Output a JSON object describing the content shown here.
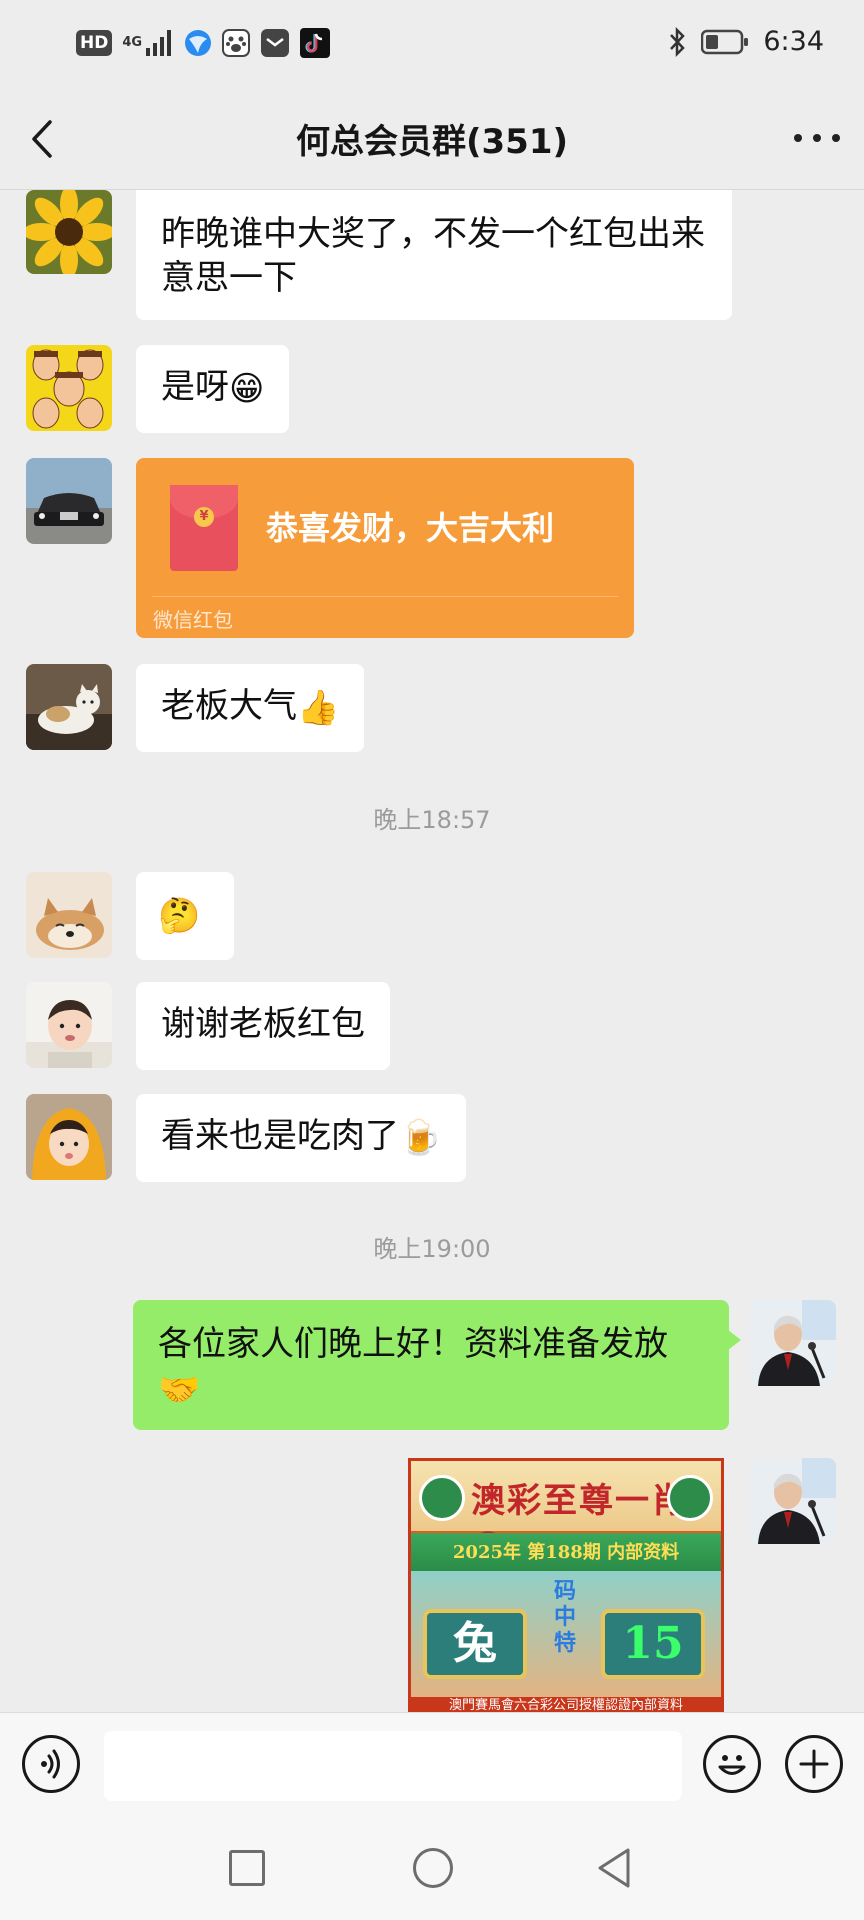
{
  "status_bar": {
    "hd_label": "HD",
    "network_label": "4G",
    "time": "6:34",
    "icons": [
      "hd-icon",
      "signal-icon",
      "browser-icon",
      "baidu-icon",
      "message-icon",
      "tiktok-icon",
      "bluetooth-icon",
      "battery-icon"
    ]
  },
  "nav": {
    "title": "何总会员群(351)"
  },
  "messages": {
    "m1": {
      "text": "昨晚谁中大奖了，不发一个红包出来意思一下"
    },
    "m2": {
      "text": "是呀",
      "emoji": "😁"
    },
    "m3": {
      "title": "恭喜发财，大吉大利",
      "footer": "微信红包"
    },
    "m4": {
      "text": "老板大气",
      "emoji": "👍"
    },
    "t1": {
      "text": "晚上18:57"
    },
    "m5": {
      "emoji": "🤔"
    },
    "m6": {
      "text": "谢谢老板红包"
    },
    "m7": {
      "text": "看来也是吃肉了",
      "emoji": "🍺"
    },
    "t2": {
      "text": "晚上19:00"
    },
    "m8": {
      "text": "各位家人们晚上好！资料准备发放",
      "emoji": "🤝"
    },
    "m9": {
      "title": "澳彩至尊一肖①码",
      "band_text": "2025年 第188期 内部资料",
      "left_box": "兔",
      "column_text": "码中特",
      "right_box": "15",
      "footer": "澳門賽馬會六合彩公司授權認證內部資料"
    }
  },
  "colors": {
    "background": "#ededed",
    "bubble_incoming": "#ffffff",
    "bubble_outgoing": "#95ec69",
    "red_packet": "#f79c3b",
    "timestamp": "#9b9b9b"
  }
}
